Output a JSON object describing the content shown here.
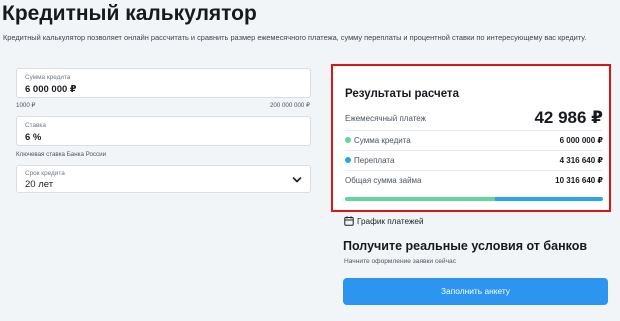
{
  "header": {
    "title": "Кредитный калькулятор",
    "description": "Кредитный калькулятор позволяет онлайн рассчитать и сравнить размер ежемесячного платежа, сумму переплаты и процентной ставки по интересующему вас кредиту."
  },
  "form": {
    "amount": {
      "label": "Сумма кредита",
      "value": "6 000 000 ₽",
      "min_label": "1000 ₽",
      "max_label": "200 000 000 ₽"
    },
    "rate": {
      "label": "Ставка",
      "value": "6 %",
      "hint": "Ключевая ставка Банка России"
    },
    "term": {
      "label": "Срок кредита",
      "value": "20 лет"
    }
  },
  "results": {
    "title": "Результаты расчета",
    "monthly_label": "Ежемесячный платеж",
    "monthly_value": "42 986 ₽",
    "principal_label": "Сумма кредита",
    "principal_value": "6 000 000 ₽",
    "overpay_label": "Переплата",
    "overpay_value": "4 316 640 ₽",
    "total_label": "Общая сумма займа",
    "total_value": "10 316 640 ₽",
    "principal_share": 0.5816,
    "colors": {
      "principal": "#63d69b",
      "overpay": "#2aa6e8",
      "highlight_border": "#e01414"
    }
  },
  "schedule": {
    "label": "График платежей",
    "icon": "calendar-icon"
  },
  "offers": {
    "title": "Получите реальные условия от банков",
    "subtitle": "Начните оформление заявки сейчас",
    "button_label": "Заполнить анкету",
    "button_color": "#2b95f0"
  }
}
